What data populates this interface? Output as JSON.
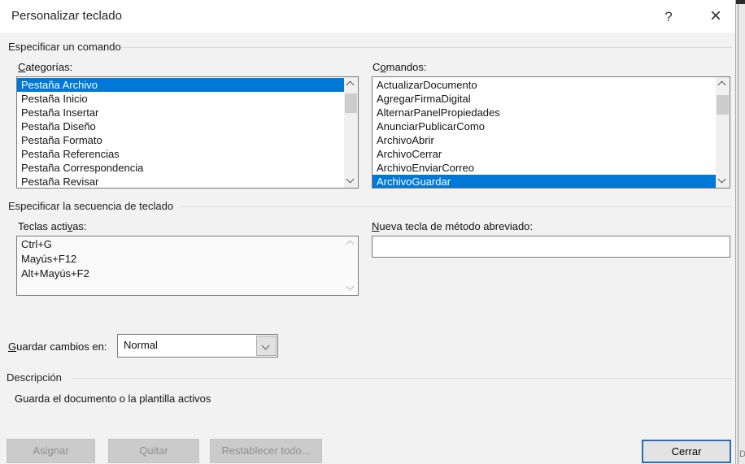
{
  "colors": {
    "selection": "#0078d7",
    "focus-border": "#2b6cb5",
    "disabled-bg": "#cbcbcb",
    "disabled-text": "#8f8f8f"
  },
  "window": {
    "title": "Personalizar teclado",
    "help_icon": "?",
    "close_icon": "×"
  },
  "background": {
    "fragment": "D"
  },
  "sections": {
    "command_heading": "Especificar un comando",
    "sequence_heading": "Especificar la secuencia de teclado",
    "description_heading": "Descripción",
    "description_text": "Guarda el documento o la plantilla activos"
  },
  "categories": {
    "label": {
      "pre": "",
      "accel": "C",
      "rest": "ategorías:"
    },
    "selected_index": 0,
    "items": [
      "Pestaña Archivo",
      "Pestaña Inicio",
      "Pestaña Insertar",
      "Pestaña Diseño",
      "Pestaña Formato",
      "Pestaña Referencias",
      "Pestaña Correspondencia",
      "Pestaña Revisar"
    ]
  },
  "commands": {
    "label": {
      "pre": "C",
      "accel": "o",
      "rest": "mandos:"
    },
    "selected_index": 7,
    "items": [
      "ActualizarDocumento",
      "AgregarFirmaDigital",
      "AlternarPanelPropiedades",
      "AnunciarPublicarComo",
      "ArchivoAbrir",
      "ArchivoCerrar",
      "ArchivoEnviarCorreo",
      "ArchivoGuardar"
    ]
  },
  "current_keys": {
    "label": {
      "pre": "Teclas acti",
      "accel": "v",
      "rest": "as:"
    },
    "items": [
      "Ctrl+G",
      "Mayús+F12",
      "Alt+Mayús+F2"
    ]
  },
  "new_key": {
    "label": {
      "pre": "",
      "accel": "N",
      "rest": "ueva tecla de método abreviado:"
    },
    "value": "",
    "placeholder": ""
  },
  "save_in": {
    "label": {
      "pre": "",
      "accel": "G",
      "rest": "uardar cambios en:"
    },
    "value": "Normal"
  },
  "buttons": {
    "assign": "Asignar",
    "remove": "Quitar",
    "reset": "Restablecer todo...",
    "close": "Cerrar"
  }
}
